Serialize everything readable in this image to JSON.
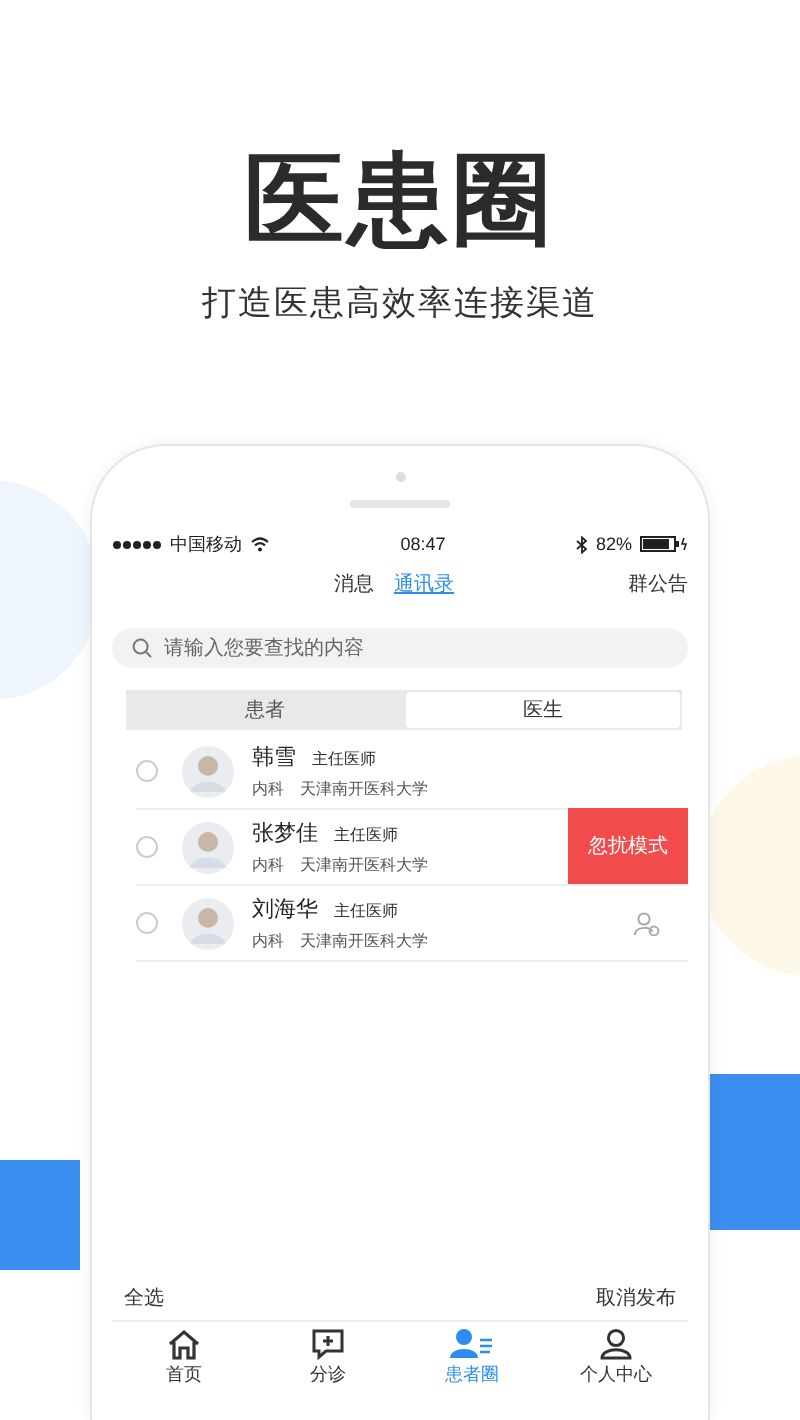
{
  "header": {
    "title": "医患圈",
    "subtitle": "打造医患高效率连接渠道"
  },
  "status_bar": {
    "carrier": "中国移动",
    "time": "08:47",
    "battery": "82%"
  },
  "nav": {
    "tabs": [
      {
        "label": "消息",
        "selected": false
      },
      {
        "label": "通讯录",
        "selected": true
      }
    ],
    "action": "群公告"
  },
  "search": {
    "placeholder": "请输入您要查找的内容"
  },
  "segments": [
    {
      "label": "患者",
      "selected": false
    },
    {
      "label": "医生",
      "selected": true
    }
  ],
  "doctors": [
    {
      "name": "韩雪",
      "title": "主任医师",
      "department": "内科",
      "hospital": "天津南开医科大学",
      "checked": false,
      "add_icon": false
    },
    {
      "name": "张梦佳",
      "title": "主任医师",
      "department": "内科",
      "hospital": "天津南开医科大学",
      "checked": false,
      "add_icon": false,
      "swipe_action": "忽扰模式"
    },
    {
      "name": "刘海华",
      "title": "主任医师",
      "department": "内科",
      "hospital": "天津南开医科大学",
      "checked": false,
      "add_icon": true
    }
  ],
  "footer": {
    "select_all": "全选",
    "cancel": "取消发布"
  },
  "bottom_tabs": [
    {
      "kind": "home",
      "label": "首页",
      "selected": false
    },
    {
      "kind": "triage",
      "label": "分诊",
      "selected": false
    },
    {
      "kind": "circle",
      "label": "患者圈",
      "selected": true
    },
    {
      "kind": "profile",
      "label": "个人中心",
      "selected": false
    }
  ]
}
